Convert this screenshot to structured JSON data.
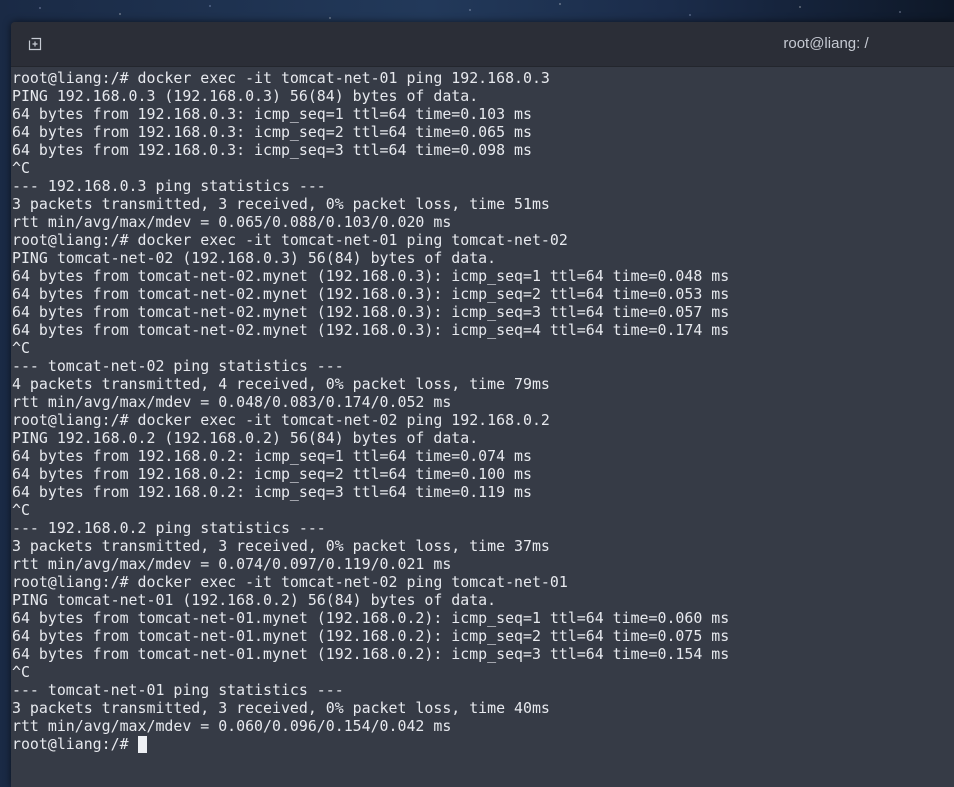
{
  "window": {
    "title": "root@liang: /"
  },
  "colors": {
    "titlebar": "#2b2e37",
    "terminal_bg": "#363b46",
    "text": "#e7e9ee"
  },
  "icons": {
    "new_tab": "new-tab-icon"
  },
  "terminal": {
    "lines": [
      "root@liang:/# docker exec -it tomcat-net-01 ping 192.168.0.3",
      "PING 192.168.0.3 (192.168.0.3) 56(84) bytes of data.",
      "64 bytes from 192.168.0.3: icmp_seq=1 ttl=64 time=0.103 ms",
      "64 bytes from 192.168.0.3: icmp_seq=2 ttl=64 time=0.065 ms",
      "64 bytes from 192.168.0.3: icmp_seq=3 ttl=64 time=0.098 ms",
      "^C",
      "--- 192.168.0.3 ping statistics ---",
      "3 packets transmitted, 3 received, 0% packet loss, time 51ms",
      "rtt min/avg/max/mdev = 0.065/0.088/0.103/0.020 ms",
      "root@liang:/# docker exec -it tomcat-net-01 ping tomcat-net-02",
      "PING tomcat-net-02 (192.168.0.3) 56(84) bytes of data.",
      "64 bytes from tomcat-net-02.mynet (192.168.0.3): icmp_seq=1 ttl=64 time=0.048 ms",
      "64 bytes from tomcat-net-02.mynet (192.168.0.3): icmp_seq=2 ttl=64 time=0.053 ms",
      "64 bytes from tomcat-net-02.mynet (192.168.0.3): icmp_seq=3 ttl=64 time=0.057 ms",
      "64 bytes from tomcat-net-02.mynet (192.168.0.3): icmp_seq=4 ttl=64 time=0.174 ms",
      "^C",
      "--- tomcat-net-02 ping statistics ---",
      "4 packets transmitted, 4 received, 0% packet loss, time 79ms",
      "rtt min/avg/max/mdev = 0.048/0.083/0.174/0.052 ms",
      "root@liang:/# docker exec -it tomcat-net-02 ping 192.168.0.2",
      "PING 192.168.0.2 (192.168.0.2) 56(84) bytes of data.",
      "64 bytes from 192.168.0.2: icmp_seq=1 ttl=64 time=0.074 ms",
      "64 bytes from 192.168.0.2: icmp_seq=2 ttl=64 time=0.100 ms",
      "64 bytes from 192.168.0.2: icmp_seq=3 ttl=64 time=0.119 ms",
      "^C",
      "--- 192.168.0.2 ping statistics ---",
      "3 packets transmitted, 3 received, 0% packet loss, time 37ms",
      "rtt min/avg/max/mdev = 0.074/0.097/0.119/0.021 ms",
      "root@liang:/# docker exec -it tomcat-net-02 ping tomcat-net-01",
      "PING tomcat-net-01 (192.168.0.2) 56(84) bytes of data.",
      "64 bytes from tomcat-net-01.mynet (192.168.0.2): icmp_seq=1 ttl=64 time=0.060 ms",
      "64 bytes from tomcat-net-01.mynet (192.168.0.2): icmp_seq=2 ttl=64 time=0.075 ms",
      "64 bytes from tomcat-net-01.mynet (192.168.0.2): icmp_seq=3 ttl=64 time=0.154 ms",
      "^C",
      "--- tomcat-net-01 ping statistics ---",
      "3 packets transmitted, 3 received, 0% packet loss, time 40ms",
      "rtt min/avg/max/mdev = 0.060/0.096/0.154/0.042 ms"
    ],
    "prompt": "root@liang:/#"
  }
}
